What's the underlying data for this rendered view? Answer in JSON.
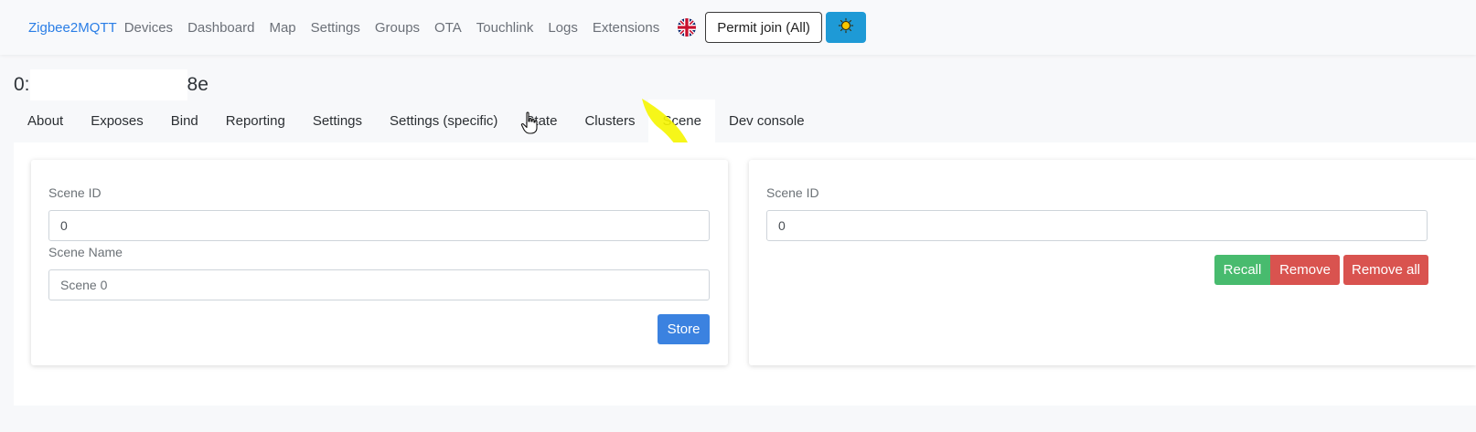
{
  "navbar": {
    "brand": "Zigbee2MQTT",
    "links": [
      "Devices",
      "Dashboard",
      "Map",
      "Settings",
      "Groups",
      "OTA",
      "Touchlink",
      "Logs",
      "Extensions"
    ],
    "language_icon": "uk-flag-icon",
    "permit_join_label": "Permit join (All)",
    "theme_icon": "sun-icon"
  },
  "device": {
    "title_prefix": "0:",
    "title_suffix": "8e"
  },
  "tabs": [
    "About",
    "Exposes",
    "Bind",
    "Reporting",
    "Settings",
    "Settings (specific)",
    "State",
    "Clusters",
    "Scene",
    "Dev console"
  ],
  "active_tab": "Scene",
  "store_card": {
    "scene_id_label": "Scene ID",
    "scene_id_value": "0",
    "scene_name_label": "Scene Name",
    "scene_name_placeholder": "Scene 0",
    "store_label": "Store"
  },
  "recall_card": {
    "scene_id_label": "Scene ID",
    "scene_id_value": "0",
    "recall_label": "Recall",
    "remove_label": "Remove",
    "remove_all_label": "Remove all"
  },
  "colors": {
    "brand": "#2a7ee6",
    "primary": "#3b82e0",
    "success": "#48bb6e",
    "danger": "#d9534f",
    "theme_button": "#1e9ad6",
    "highlight": "#f5f500"
  }
}
